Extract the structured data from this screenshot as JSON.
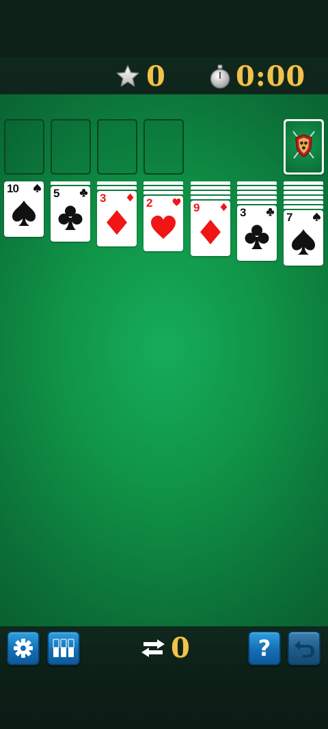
{
  "score": {
    "icon": "star-icon",
    "value": "0"
  },
  "timer": {
    "icon": "stopwatch-icon",
    "value": "0:00"
  },
  "foundations": [
    {
      "suit": ""
    },
    {
      "suit": ""
    },
    {
      "suit": ""
    },
    {
      "suit": ""
    }
  ],
  "stock": {
    "icon": "shield-swords-card-back-icon",
    "face_down": true
  },
  "tableau": [
    {
      "hidden": 0,
      "rank": "10",
      "suit": "spade",
      "color": "black"
    },
    {
      "hidden": 1,
      "rank": "5",
      "suit": "club",
      "color": "black"
    },
    {
      "hidden": 2,
      "rank": "3",
      "suit": "diamond",
      "color": "red"
    },
    {
      "hidden": 3,
      "rank": "2",
      "suit": "heart",
      "color": "red"
    },
    {
      "hidden": 4,
      "rank": "9",
      "suit": "diamond",
      "color": "red"
    },
    {
      "hidden": 5,
      "rank": "3",
      "suit": "club",
      "color": "black"
    },
    {
      "hidden": 6,
      "rank": "7",
      "suit": "spade",
      "color": "black"
    }
  ],
  "bottom": {
    "settings_icon": "gear-icon",
    "stats_icon": "card-columns-icon",
    "moves_icon": "swap-arrows-icon",
    "moves_value": "0",
    "help_label": "?",
    "undo_icon": "undo-icon"
  },
  "colors": {
    "felt": "#109547",
    "gold": "#f2c24b",
    "button": "#1e82c8",
    "red_suit": "#f01616"
  }
}
